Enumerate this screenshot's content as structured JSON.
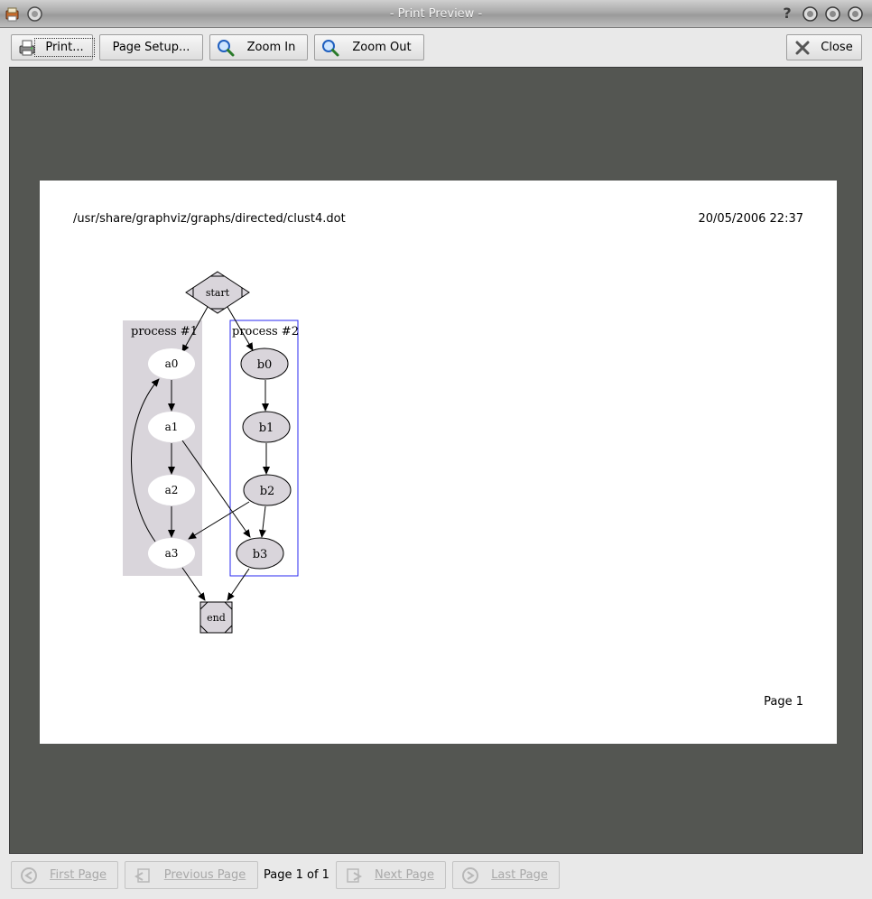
{
  "window": {
    "title": "- Print Preview -"
  },
  "toolbar": {
    "print_label": "Print...",
    "page_setup_label": "Page Setup...",
    "zoom_in_label": "Zoom In",
    "zoom_out_label": "Zoom Out",
    "close_label": "Close"
  },
  "page": {
    "file_path": "/usr/share/graphviz/graphs/directed/clust4.dot",
    "datetime": "20/05/2006 22:37",
    "footer": "Page 1"
  },
  "graph": {
    "start": "start",
    "end": "end",
    "cluster1": {
      "label": "process #1",
      "fill": "#d9d5db",
      "nodes": [
        "a0",
        "a1",
        "a2",
        "a3"
      ]
    },
    "cluster2": {
      "label": "process #2",
      "border": "#2a2af0",
      "nodes": [
        "b0",
        "b1",
        "b2",
        "b3"
      ]
    }
  },
  "nav": {
    "first_label": "First Page",
    "previous_label": "Previous Page",
    "page_info": "Page 1 of 1",
    "next_label": "Next Page",
    "last_label": "Last Page"
  },
  "colors": {
    "preview_bg": "#545652",
    "node_fill": "#d9d5db",
    "cluster_border": "#2a2af0"
  }
}
